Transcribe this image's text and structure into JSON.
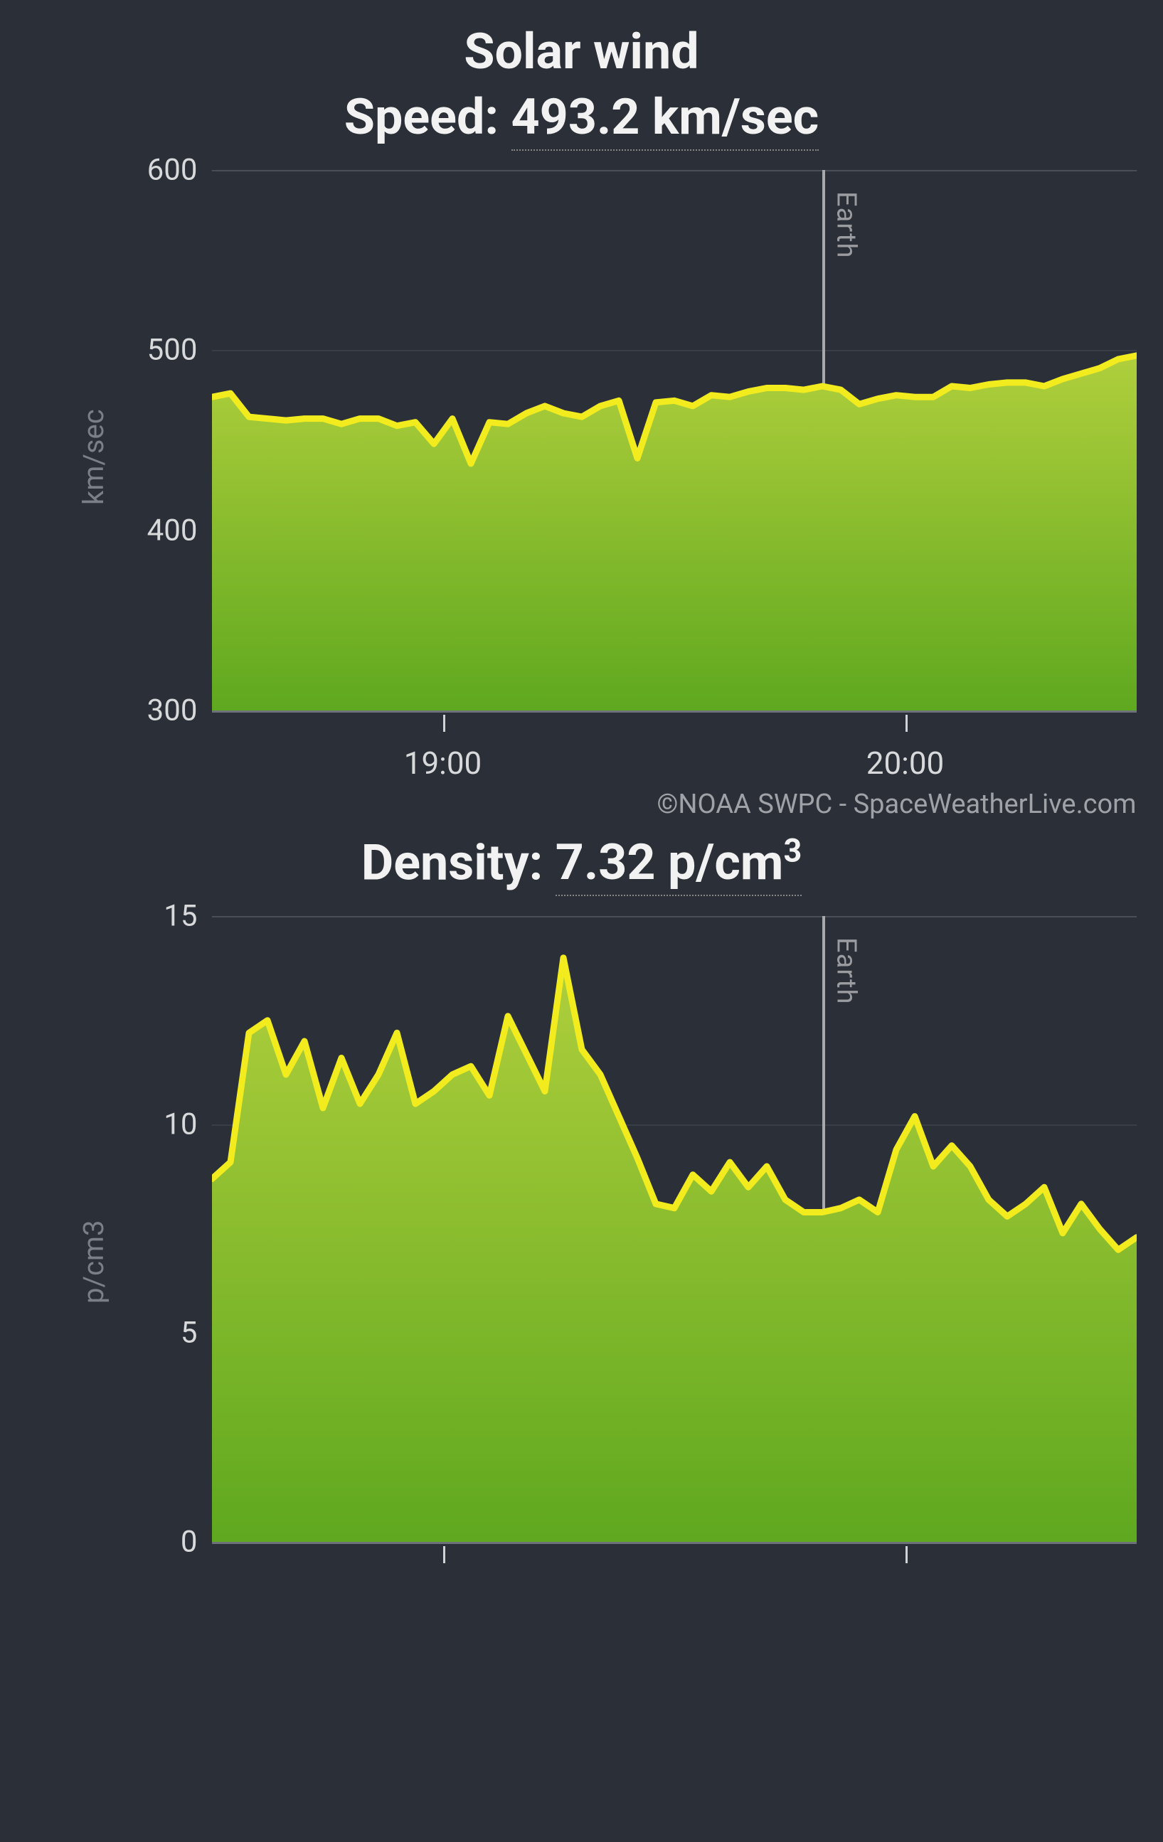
{
  "attribution": "©NOAA SWPC - SpaceWeatherLive.com",
  "earth_marker_label": "Earth",
  "chart_data": [
    {
      "type": "area",
      "title_line1": "Solar wind",
      "title_line2_prefix": "Speed: ",
      "title_line2_value": "493.2 km/sec",
      "ylabel": "km/sec",
      "ylim": [
        300,
        600
      ],
      "y_ticks": [
        300,
        400,
        500,
        600
      ],
      "x_ticks": [
        "19:00",
        "20:00"
      ],
      "x_tick_positions": [
        0.25,
        0.75
      ],
      "earth_marker_x": 0.66,
      "x": [
        0.0,
        0.02,
        0.04,
        0.06,
        0.08,
        0.1,
        0.12,
        0.14,
        0.16,
        0.18,
        0.2,
        0.22,
        0.24,
        0.26,
        0.28,
        0.3,
        0.32,
        0.34,
        0.36,
        0.38,
        0.4,
        0.42,
        0.44,
        0.46,
        0.48,
        0.5,
        0.52,
        0.54,
        0.56,
        0.58,
        0.6,
        0.62,
        0.64,
        0.66,
        0.68,
        0.7,
        0.72,
        0.74,
        0.76,
        0.78,
        0.8,
        0.82,
        0.84,
        0.86,
        0.88,
        0.9,
        0.92,
        0.94,
        0.96,
        0.98,
        1.0
      ],
      "values": [
        474,
        476,
        463,
        462,
        461,
        462,
        462,
        459,
        462,
        462,
        458,
        460,
        448,
        462,
        437,
        460,
        459,
        465,
        469,
        465,
        463,
        469,
        472,
        440,
        471,
        472,
        469,
        475,
        474,
        477,
        479,
        479,
        478,
        480,
        478,
        470,
        473,
        475,
        474,
        474,
        480,
        479,
        481,
        482,
        482,
        480,
        484,
        487,
        490,
        495,
        497
      ],
      "stroke": "#f2ec1f",
      "fill_top": "#b0cf3c",
      "fill_bottom": "#5fa81f"
    },
    {
      "type": "area",
      "title_prefix": "Density: ",
      "title_value": "7.32 p/cm",
      "title_sup": "3",
      "ylabel": "p/cm3",
      "ylim": [
        0,
        15
      ],
      "y_ticks": [
        0,
        5,
        10,
        15
      ],
      "x_ticks": [
        "19:00",
        "20:00"
      ],
      "x_tick_positions": [
        0.25,
        0.75
      ],
      "earth_marker_x": 0.66,
      "x": [
        0.0,
        0.02,
        0.04,
        0.06,
        0.08,
        0.1,
        0.12,
        0.14,
        0.16,
        0.18,
        0.2,
        0.22,
        0.24,
        0.26,
        0.28,
        0.3,
        0.32,
        0.34,
        0.36,
        0.38,
        0.4,
        0.42,
        0.44,
        0.46,
        0.48,
        0.5,
        0.52,
        0.54,
        0.56,
        0.58,
        0.6,
        0.62,
        0.64,
        0.66,
        0.68,
        0.7,
        0.72,
        0.74,
        0.76,
        0.78,
        0.8,
        0.82,
        0.84,
        0.86,
        0.88,
        0.9,
        0.92,
        0.94,
        0.96,
        0.98,
        1.0
      ],
      "values": [
        8.7,
        9.1,
        12.2,
        12.5,
        11.2,
        12.0,
        10.4,
        11.6,
        10.5,
        11.2,
        12.2,
        10.5,
        10.8,
        11.2,
        11.4,
        10.7,
        12.6,
        11.7,
        10.8,
        14.0,
        11.8,
        11.2,
        10.2,
        9.2,
        8.1,
        8.0,
        8.8,
        8.4,
        9.1,
        8.5,
        9.0,
        8.2,
        7.9,
        7.9,
        8.0,
        8.2,
        7.9,
        9.4,
        10.2,
        9.0,
        9.5,
        9.0,
        8.2,
        7.8,
        8.1,
        8.5,
        7.4,
        8.1,
        7.5,
        7.0,
        7.3
      ],
      "stroke": "#f2ec1f",
      "fill_top": "#b0cf3c",
      "fill_bottom": "#5fa81f"
    }
  ]
}
